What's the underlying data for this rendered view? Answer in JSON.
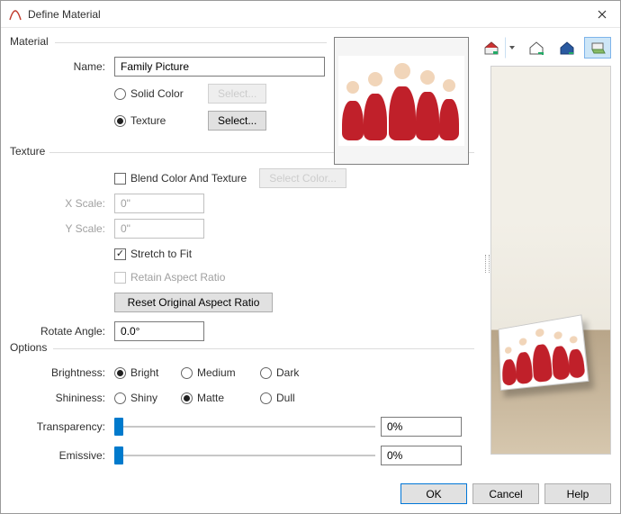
{
  "window": {
    "title": "Define Material"
  },
  "material": {
    "legend": "Material",
    "name_label": "Name:",
    "name_value": "Family Picture",
    "solid_label": "Solid Color",
    "texture_label": "Texture",
    "selected": "texture",
    "select_btn": "Select..."
  },
  "texture": {
    "legend": "Texture",
    "blend_label": "Blend Color And Texture",
    "select_color_btn": "Select Color...",
    "xscale_label": "X Scale:",
    "xscale_value": "0\"",
    "yscale_label": "Y Scale:",
    "yscale_value": "0\"",
    "stretch_label": "Stretch to Fit",
    "retain_label": "Retain Aspect Ratio",
    "reset_btn": "Reset Original Aspect Ratio",
    "rotate_label": "Rotate Angle:",
    "rotate_value": "0.0°"
  },
  "options": {
    "legend": "Options",
    "brightness_label": "Brightness:",
    "brightness_opts": [
      "Bright",
      "Medium",
      "Dark"
    ],
    "brightness_sel": 0,
    "shininess_label": "Shininess:",
    "shininess_opts": [
      "Shiny",
      "Matte",
      "Dull"
    ],
    "shininess_sel": 1,
    "transparency_label": "Transparency:",
    "transparency_value": "0%",
    "emissive_label": "Emissive:",
    "emissive_value": "0%"
  },
  "toolbar": {
    "icons": [
      "house-color-icon",
      "house-frame-icon",
      "house-blueprint-icon",
      "wall-plane-icon"
    ],
    "selected": 3
  },
  "footer": {
    "ok": "OK",
    "cancel": "Cancel",
    "help": "Help"
  }
}
